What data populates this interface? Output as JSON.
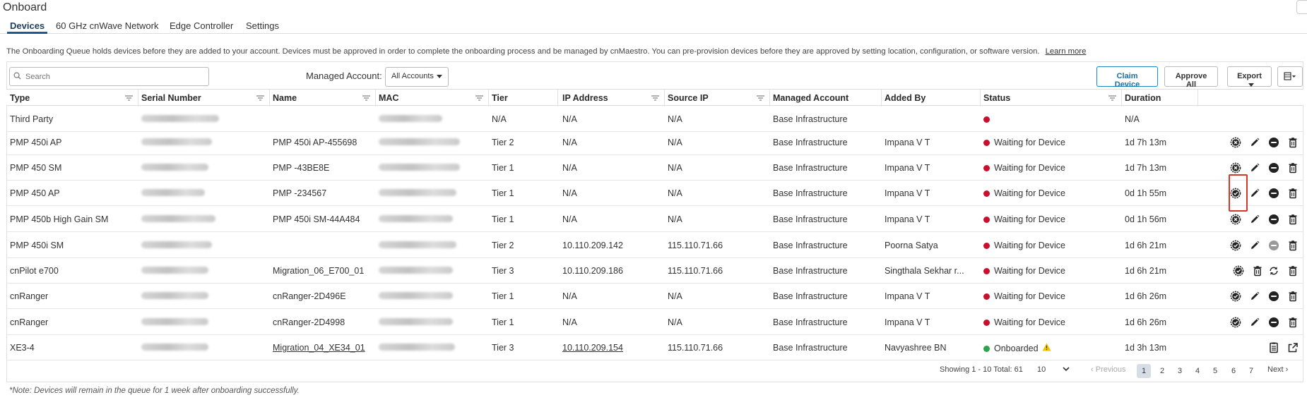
{
  "page": {
    "title": "Onboard"
  },
  "tabs": [
    "Devices",
    "60 GHz cnWave Network",
    "Edge Controller",
    "Settings"
  ],
  "info": {
    "text": "The Onboarding Queue holds devices before they are added to your account. Devices must be approved in order to complete the onboarding process and be managed by cnMaestro. You can pre-provision devices before they are approved by setting location, configuration, or software version.",
    "link": "Learn more"
  },
  "toolbar": {
    "search_placeholder": "Search",
    "managed_account_label": "Managed Account:",
    "managed_account_value": "All Accounts",
    "claim_device": "Claim Device",
    "approve_all": "Approve All",
    "export": "Export"
  },
  "columns": [
    "Type",
    "Serial Number",
    "Name",
    "MAC",
    "Tier",
    "IP Address",
    "Source IP",
    "Managed Account",
    "Added By",
    "Status",
    "Duration"
  ],
  "rows": [
    {
      "type": "Third Party",
      "name": "",
      "tier": "N/A",
      "ip": "N/A",
      "source_ip": "N/A",
      "account": "Base Infrastructure",
      "added_by": "",
      "status": "",
      "status_color": "#c8102e",
      "duration": "N/A"
    },
    {
      "type": "PMP 450i AP",
      "name": "PMP 450i AP-455698",
      "tier": "Tier 2",
      "ip": "N/A",
      "source_ip": "N/A",
      "account": "Base Infrastructure",
      "added_by": "Impana V T",
      "status": "Waiting for Device",
      "status_color": "#c8102e",
      "duration": "1d 7h 13m"
    },
    {
      "type": "PMP 450 SM",
      "name": "PMP -43BE8E",
      "tier": "Tier 1",
      "ip": "N/A",
      "source_ip": "N/A",
      "account": "Base Infrastructure",
      "added_by": "Impana V T",
      "status": "Waiting for Device",
      "status_color": "#c8102e",
      "duration": "1d 7h 13m"
    },
    {
      "type": "PMP 450 AP",
      "name": "PMP -234567",
      "tier": "Tier 1",
      "ip": "N/A",
      "source_ip": "N/A",
      "account": "Base Infrastructure",
      "added_by": "Impana V T",
      "status": "Waiting for Device",
      "status_color": "#c8102e",
      "duration": "0d 1h 55m"
    },
    {
      "type": "PMP 450b High Gain SM",
      "name": "PMP 450i SM-44A484",
      "tier": "Tier 1",
      "ip": "N/A",
      "source_ip": "N/A",
      "account": "Base Infrastructure",
      "added_by": "Impana V T",
      "status": "Waiting for Device",
      "status_color": "#c8102e",
      "duration": "0d 1h 56m"
    },
    {
      "type": "PMP 450i SM",
      "name": "",
      "tier": "Tier 2",
      "ip": "10.110.209.142",
      "source_ip": "115.110.71.66",
      "account": "Base Infrastructure",
      "added_by": "Poorna Satya",
      "status": "Waiting for Device",
      "status_color": "#c8102e",
      "duration": "1d 6h 21m"
    },
    {
      "type": "cnPilot e700",
      "name": "Migration_06_E700_01",
      "tier": "Tier 3",
      "ip": "10.110.209.186",
      "source_ip": "115.110.71.66",
      "account": "Base Infrastructure",
      "added_by": "Singthala Sekhar r...",
      "status": "Waiting for Device",
      "status_color": "#c8102e",
      "duration": "1d 6h 21m"
    },
    {
      "type": "cnRanger",
      "name": "cnRanger-2D496E",
      "tier": "Tier 1",
      "ip": "N/A",
      "source_ip": "N/A",
      "account": "Base Infrastructure",
      "added_by": "Impana V T",
      "status": "Waiting for Device",
      "status_color": "#c8102e",
      "duration": "1d 6h 26m"
    },
    {
      "type": "cnRanger",
      "name": "cnRanger-2D4998",
      "tier": "Tier 1",
      "ip": "N/A",
      "source_ip": "N/A",
      "account": "Base Infrastructure",
      "added_by": "Impana V T",
      "status": "Waiting for Device",
      "status_color": "#c8102e",
      "duration": "1d 6h 26m"
    },
    {
      "type": "XE3-4",
      "name": "Migration_04_XE34_01",
      "tier": "Tier 3",
      "ip": "10.110.209.154",
      "source_ip": "115.110.71.66",
      "account": "Base Infrastructure",
      "added_by": "Navyashree BN",
      "status": "Onboarded",
      "status_color": "#2ea44f",
      "duration": "1d 3h 13m"
    }
  ],
  "pagination": {
    "showing": "Showing 1 - 10 Total: 61",
    "page_size": "10",
    "previous": "Previous",
    "next": "Next",
    "pages": [
      "1",
      "2",
      "3",
      "4",
      "5",
      "6",
      "7"
    ],
    "current": "1"
  },
  "note": "*Note: Devices will remain in the queue for 1 week after onboarding successfully.",
  "icons": [
    "approve-icon",
    "edit-icon",
    "remove-icon",
    "delete-icon",
    "sync-icon",
    "details-icon",
    "open-external-icon",
    "warning-icon",
    "filter-icon",
    "search-icon",
    "refresh-icon",
    "columns-icon"
  ]
}
